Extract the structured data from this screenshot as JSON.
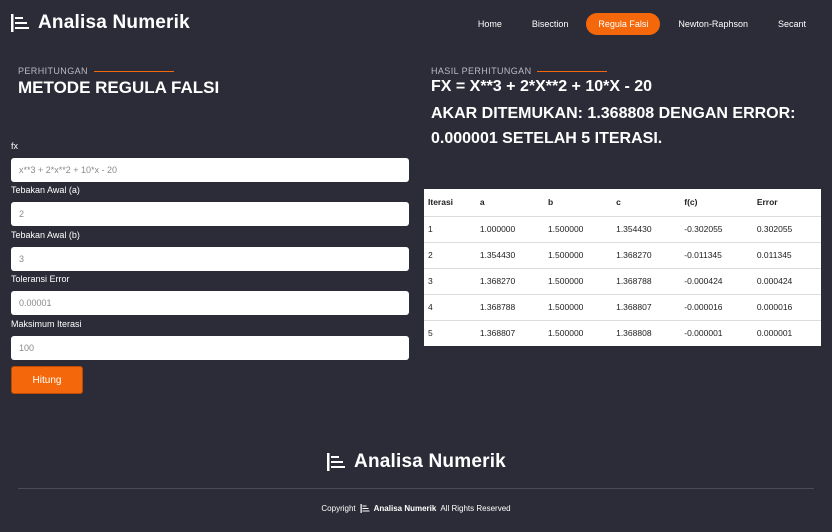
{
  "brand": {
    "name": "Analisa Numerik"
  },
  "nav": {
    "items": [
      {
        "label": "Home"
      },
      {
        "label": "Bisection"
      },
      {
        "label": "Regula Falsi",
        "active": true
      },
      {
        "label": "Newton-Raphson"
      },
      {
        "label": "Secant"
      }
    ]
  },
  "calc": {
    "kicker": "PERHITUNGAN",
    "title": "METODE REGULA FALSI",
    "fields": {
      "fx": {
        "label": "fx",
        "value": "x**3 + 2*x**2 + 10*x - 20"
      },
      "a": {
        "label": "Tebakan Awal (a)",
        "value": "2"
      },
      "b": {
        "label": "Tebakan Awal (b)",
        "value": "3"
      },
      "tol": {
        "label": "Toleransi Error",
        "value": "0.00001"
      },
      "maxit": {
        "label": "Maksimum Iterasi",
        "value": "100"
      }
    },
    "button": "Hitung"
  },
  "result": {
    "kicker": "HASIL PERHITUNGAN",
    "fx": "FX = X**3 + 2*X**2 + 10*X - 20",
    "message": "AKAR DITEMUKAN: 1.368808 DENGAN ERROR: 0.000001 SETELAH 5 ITERASI.",
    "table": {
      "headers": [
        "Iterasi",
        "a",
        "b",
        "c",
        "f(c)",
        "Error"
      ],
      "rows": [
        [
          "1",
          "1.000000",
          "1.500000",
          "1.354430",
          "-0.302055",
          "0.302055"
        ],
        [
          "2",
          "1.354430",
          "1.500000",
          "1.368270",
          "-0.011345",
          "0.011345"
        ],
        [
          "3",
          "1.368270",
          "1.500000",
          "1.368788",
          "-0.000424",
          "0.000424"
        ],
        [
          "4",
          "1.368788",
          "1.500000",
          "1.368807",
          "-0.000016",
          "0.000016"
        ],
        [
          "5",
          "1.368807",
          "1.500000",
          "1.368808",
          "-0.000001",
          "0.000001"
        ]
      ]
    }
  },
  "footer": {
    "brand": "Analisa Numerik",
    "copyright_prefix": "Copyright",
    "copyright_brand": "Analisa Numerik",
    "copyright_suffix": "All Rights Reserved"
  },
  "colors": {
    "accent": "#f4680b",
    "background": "#2b2c37"
  },
  "icons": {
    "brand": "bar-list-icon"
  }
}
